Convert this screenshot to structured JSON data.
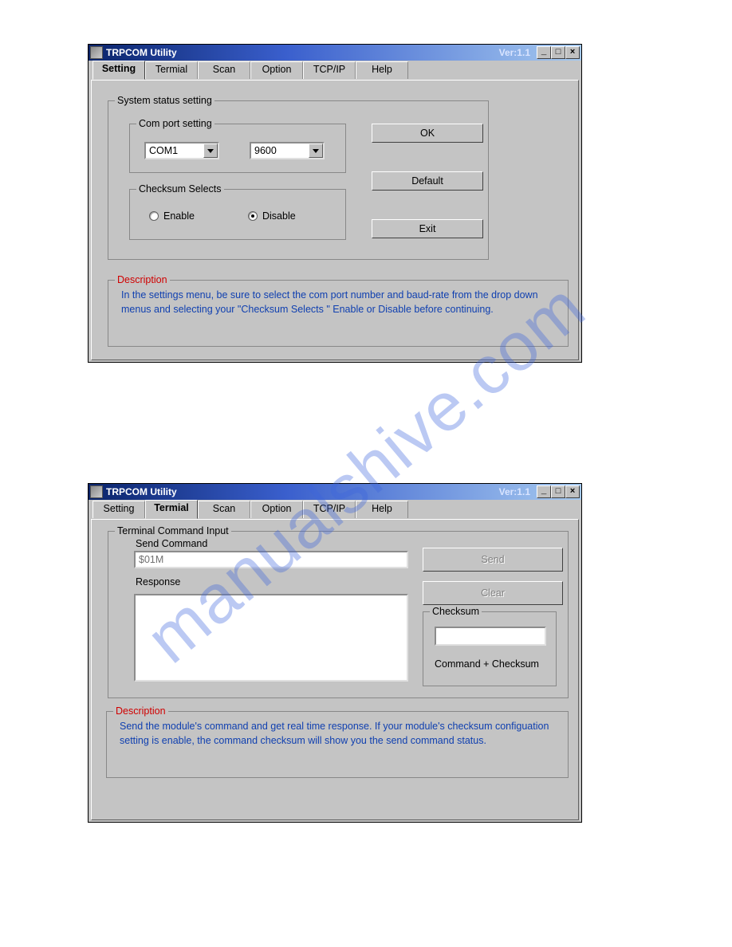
{
  "watermark": "manualshive.com",
  "titlebar": {
    "title": "TRPCOM Utility",
    "version": "Ver:1.1"
  },
  "window_controls": {
    "minimize": "_",
    "maximize": "□",
    "close": "×"
  },
  "tabs": [
    "Setting",
    "Termial",
    "Scan",
    "Option",
    "TCP/IP",
    "Help"
  ],
  "window1": {
    "active_tab": 0,
    "system_status": {
      "legend": "System status setting",
      "com_port": {
        "legend": "Com port setting",
        "port": "COM1",
        "baud": "9600"
      },
      "checksum": {
        "legend": "Checksum Selects",
        "enable": "Enable",
        "disable": "Disable",
        "selected": "disable"
      }
    },
    "buttons": {
      "ok": "OK",
      "default": "Default",
      "exit": "Exit"
    },
    "description": {
      "legend": "Description",
      "text": "In the settings menu, be sure to select the com port number and baud-rate from the drop down menus and selecting your \"Checksum Selects \" Enable or Disable before continuing."
    }
  },
  "window2": {
    "active_tab": 1,
    "terminal": {
      "legend": "Terminal Command Input",
      "send_label": "Send Command",
      "send_value": "$01M",
      "response_label": "Response",
      "response_value": ""
    },
    "buttons": {
      "send": "Send",
      "clear": "Clear"
    },
    "checksum": {
      "legend": "Checksum",
      "value": "",
      "footer": "Command + Checksum"
    },
    "description": {
      "legend": "Description",
      "text": "Send the module's command and get  real time response. If your module's checksum configuation setting is enable, the command checksum will show you the send command status."
    }
  }
}
